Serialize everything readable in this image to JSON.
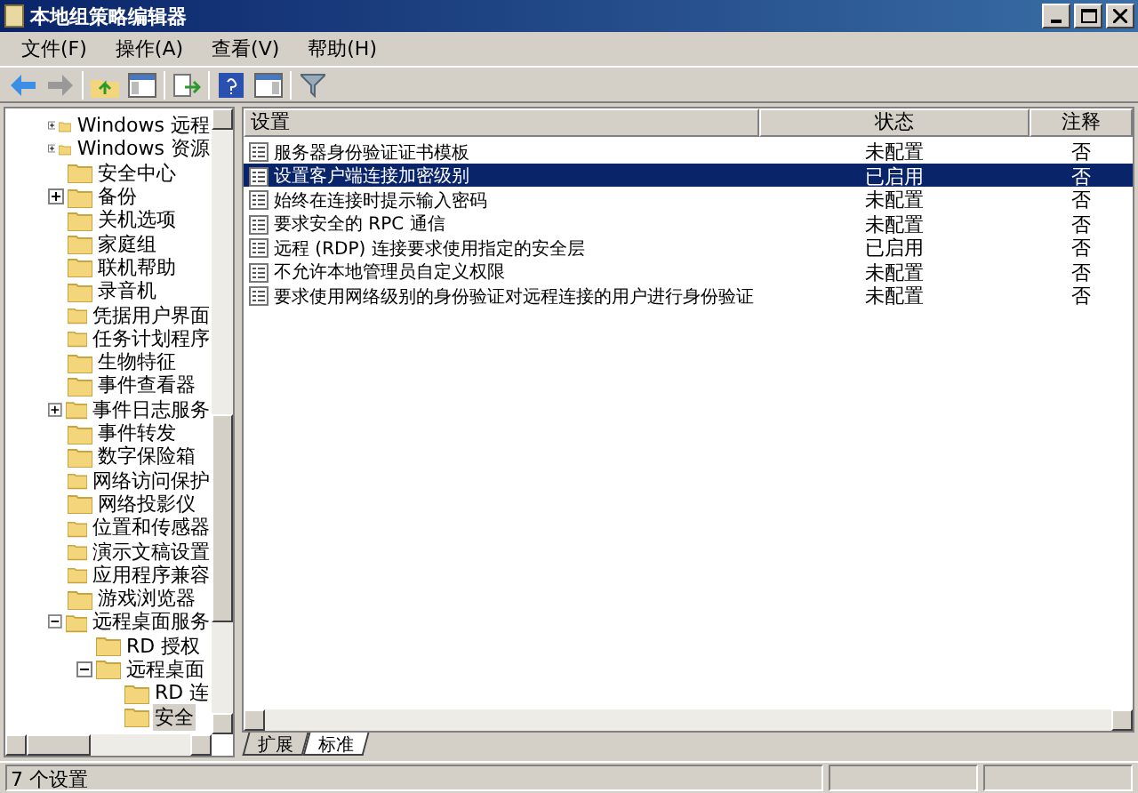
{
  "window": {
    "title": "本地组策略编辑器"
  },
  "menu": [
    {
      "label": "文件(F)"
    },
    {
      "label": "操作(A)"
    },
    {
      "label": "查看(V)"
    },
    {
      "label": "帮助(H)"
    }
  ],
  "toolbar": [
    {
      "kind": "back"
    },
    {
      "kind": "forward"
    },
    {
      "kind": "sep"
    },
    {
      "kind": "up"
    },
    {
      "kind": "tree"
    },
    {
      "kind": "sep"
    },
    {
      "kind": "export"
    },
    {
      "kind": "sep"
    },
    {
      "kind": "help"
    },
    {
      "kind": "pane"
    },
    {
      "kind": "sep"
    },
    {
      "kind": "filter"
    }
  ],
  "tree": [
    {
      "label": "Windows 远程",
      "kind": "collapsed",
      "selected": false
    },
    {
      "label": "Windows 资源",
      "kind": "collapsed",
      "selected": false
    },
    {
      "label": "安全中心",
      "kind": "leaf",
      "selected": false
    },
    {
      "label": "备份",
      "kind": "collapsed",
      "selected": false
    },
    {
      "label": "关机选项",
      "kind": "leaf",
      "selected": false
    },
    {
      "label": "家庭组",
      "kind": "leaf",
      "selected": false
    },
    {
      "label": "联机帮助",
      "kind": "leaf",
      "selected": false
    },
    {
      "label": "录音机",
      "kind": "leaf",
      "selected": false
    },
    {
      "label": "凭据用户界面",
      "kind": "leaf",
      "selected": false
    },
    {
      "label": "任务计划程序",
      "kind": "leaf",
      "selected": false
    },
    {
      "label": "生物特征",
      "kind": "leaf",
      "selected": false
    },
    {
      "label": "事件查看器",
      "kind": "leaf",
      "selected": false
    },
    {
      "label": "事件日志服务",
      "kind": "collapsed",
      "selected": false
    },
    {
      "label": "事件转发",
      "kind": "leaf",
      "selected": false
    },
    {
      "label": "数字保险箱",
      "kind": "leaf",
      "selected": false
    },
    {
      "label": "网络访问保护",
      "kind": "leaf",
      "selected": false
    },
    {
      "label": "网络投影仪",
      "kind": "leaf",
      "selected": false
    },
    {
      "label": "位置和传感器",
      "kind": "leaf",
      "selected": false
    },
    {
      "label": "演示文稿设置",
      "kind": "leaf",
      "selected": false
    },
    {
      "label": "应用程序兼容",
      "kind": "leaf",
      "selected": false
    },
    {
      "label": "游戏浏览器",
      "kind": "leaf",
      "selected": false
    },
    {
      "label": "远程桌面服务",
      "kind": "expanded",
      "selected": false,
      "children": [
        {
          "label": "RD 授权",
          "kind": "leaf",
          "selected": false
        },
        {
          "label": "远程桌面",
          "kind": "expanded",
          "selected": false,
          "children": [
            {
              "label": "RD 连",
              "kind": "leaf",
              "selected": false
            },
            {
              "label": "安全",
              "kind": "leaf",
              "selected": true
            }
          ]
        }
      ]
    }
  ],
  "table": {
    "columns": [
      "设置",
      "状态",
      "注释"
    ],
    "rows": [
      {
        "setting": "服务器身份验证证书模板",
        "state": "未配置",
        "note": "否",
        "selected": false
      },
      {
        "setting": "设置客户端连接加密级别",
        "state": "已启用",
        "note": "否",
        "selected": true
      },
      {
        "setting": "始终在连接时提示输入密码",
        "state": "未配置",
        "note": "否",
        "selected": false
      },
      {
        "setting": "要求安全的 RPC 通信",
        "state": "未配置",
        "note": "否",
        "selected": false
      },
      {
        "setting": "远程 (RDP) 连接要求使用指定的安全层",
        "state": "已启用",
        "note": "否",
        "selected": false
      },
      {
        "setting": "不允许本地管理员自定义权限",
        "state": "未配置",
        "note": "否",
        "selected": false
      },
      {
        "setting": "要求使用网络级别的身份验证对远程连接的用户进行身份验证",
        "state": "未配置",
        "note": "否",
        "selected": false
      }
    ]
  },
  "view_tabs": [
    {
      "label": "扩展",
      "selected": false
    },
    {
      "label": "标准",
      "selected": true
    }
  ],
  "status_bar": "7 个设置"
}
